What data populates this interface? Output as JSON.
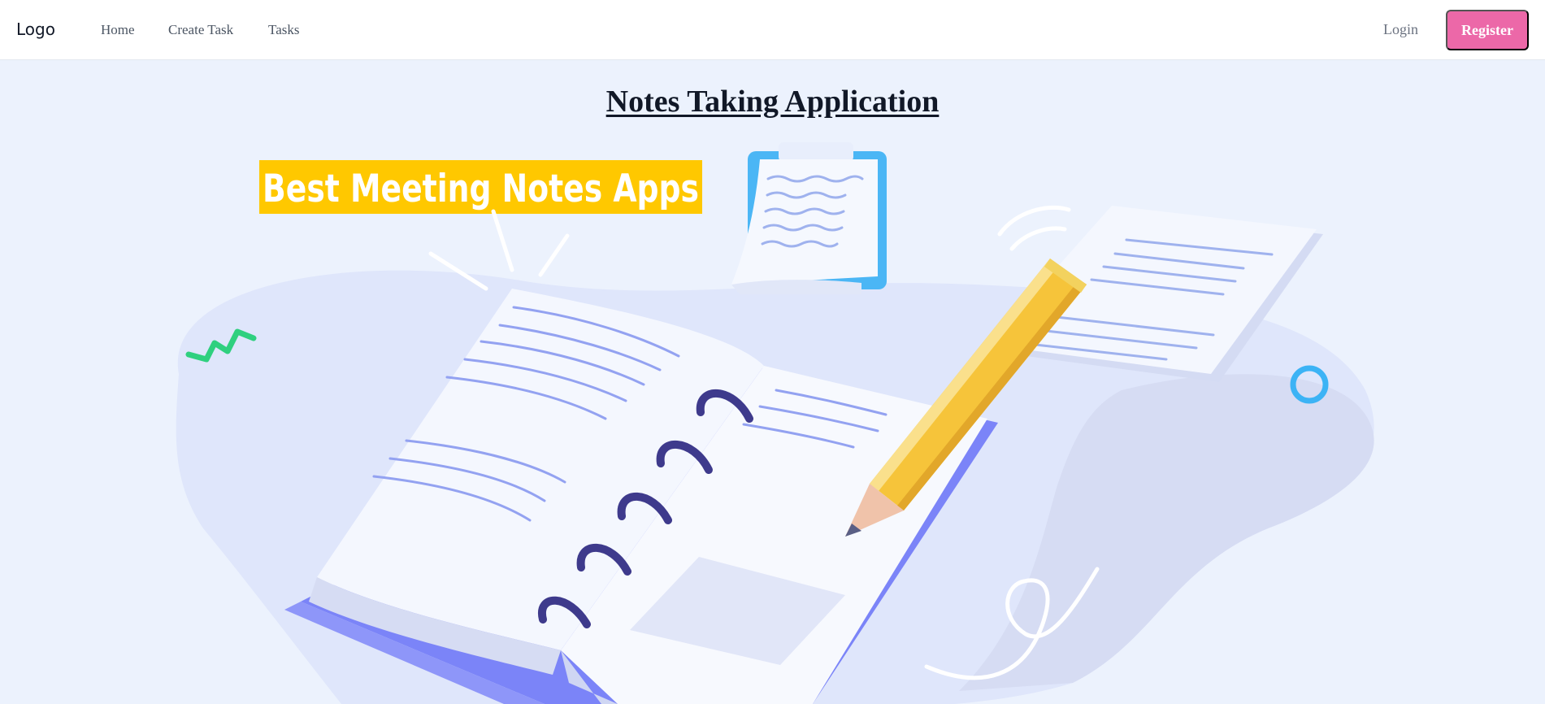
{
  "navbar": {
    "logo": "Logo",
    "links": [
      {
        "label": "Home"
      },
      {
        "label": "Create Task"
      },
      {
        "label": "Tasks"
      }
    ],
    "login_label": "Login",
    "register_label": "Register"
  },
  "main": {
    "title": "Notes Taking Application",
    "hero": {
      "banner_text": "Best Meeting Notes Apps"
    }
  },
  "colors": {
    "page_background": "#ecf2fd",
    "register_button": "#ec68a8",
    "banner": "#ffc800",
    "notebook_cover": "#7b84f8",
    "ring": "#3e3a8c",
    "pencil": "#f6c43a",
    "clipboard": "#4bb6f5"
  }
}
